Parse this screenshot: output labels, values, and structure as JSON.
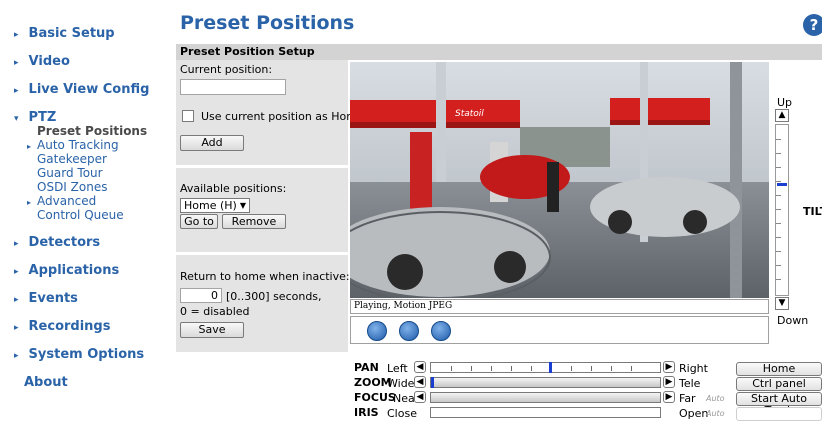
{
  "sidebar": {
    "items": [
      {
        "label": "Basic Setup"
      },
      {
        "label": "Video"
      },
      {
        "label": "Live View Config"
      },
      {
        "label": "PTZ"
      },
      {
        "label": "Detectors"
      },
      {
        "label": "Applications"
      },
      {
        "label": "Events"
      },
      {
        "label": "Recordings"
      },
      {
        "label": "System Options"
      },
      {
        "label": "About"
      }
    ],
    "ptz_sub": [
      {
        "label": "Preset Positions"
      },
      {
        "label": "Auto Tracking"
      },
      {
        "label": "Gatekeeper"
      },
      {
        "label": "Guard Tour"
      },
      {
        "label": "OSDI Zones"
      },
      {
        "label": "Advanced"
      },
      {
        "label": "Control Queue"
      }
    ]
  },
  "header": {
    "title": "Preset Positions",
    "help": "?"
  },
  "panel": {
    "title": "Preset Position Setup",
    "current_position_label": "Current position:",
    "current_position_value": "",
    "use_home_label": "Use current position as Home",
    "add_label": "Add",
    "available_label": "Available positions:",
    "available_selected": "Home (H)",
    "goto_label": "Go to",
    "remove_label": "Remove",
    "return_home_label": "Return to home when inactive:",
    "return_home_value": "0",
    "return_home_range": "[0..300] seconds,",
    "return_home_hint": "0 = disabled",
    "save_label": "Save"
  },
  "video": {
    "status": "Playing, Motion JPEG",
    "station_sign": "Statoil"
  },
  "tilt": {
    "up": "Up",
    "down": "Down",
    "label": "TILT",
    "level": 0.35
  },
  "ptz": {
    "pan": {
      "key": "PAN",
      "min": "Left",
      "max": "Right",
      "value": 0.52
    },
    "zoom": {
      "key": "ZOOM",
      "min": "Wide",
      "max": "Tele",
      "value": 0.0
    },
    "focus": {
      "key": "FOCUS",
      "min": "Near",
      "max": "Far",
      "auto": "Auto"
    },
    "iris": {
      "key": "IRIS",
      "min": "Close",
      "max": "Open",
      "auto": "Auto"
    }
  },
  "right_buttons": {
    "home": "Home",
    "ctrl_panel": "Ctrl panel",
    "auto_track": "Start Auto Track"
  },
  "colors": {
    "accent": "#2a63a8",
    "panel_bg": "#e4e4e4",
    "header_bg": "#d3d3d3",
    "slider_thumb": "#1a3fd0"
  }
}
